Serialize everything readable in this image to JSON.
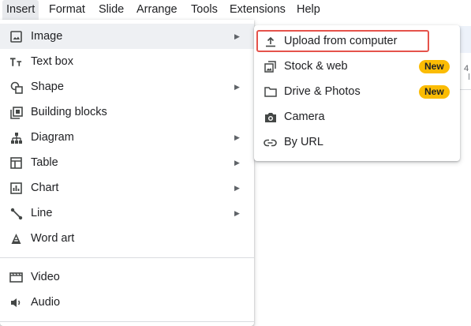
{
  "menubar": {
    "items": [
      "Insert",
      "Format",
      "Slide",
      "Arrange",
      "Tools",
      "Extensions",
      "Help"
    ]
  },
  "background": {
    "ruler_tick": "4"
  },
  "insert_menu": {
    "items": [
      {
        "label": "Image",
        "icon": "image-icon",
        "submenu": true
      },
      {
        "label": "Text box",
        "icon": "text-box-icon",
        "submenu": false
      },
      {
        "label": "Shape",
        "icon": "shape-icon",
        "submenu": true
      },
      {
        "label": "Building blocks",
        "icon": "building-blocks-icon",
        "submenu": false
      },
      {
        "label": "Diagram",
        "icon": "diagram-icon",
        "submenu": true
      },
      {
        "label": "Table",
        "icon": "table-icon",
        "submenu": true
      },
      {
        "label": "Chart",
        "icon": "chart-icon",
        "submenu": true
      },
      {
        "label": "Line",
        "icon": "line-icon",
        "submenu": true
      },
      {
        "label": "Word art",
        "icon": "word-art-icon",
        "submenu": false
      },
      {
        "label": "Video",
        "icon": "video-icon",
        "submenu": false
      },
      {
        "label": "Audio",
        "icon": "audio-icon",
        "submenu": false
      }
    ],
    "arrow": "▶"
  },
  "image_submenu": {
    "items": [
      {
        "label": "Upload from computer",
        "icon": "upload-icon"
      },
      {
        "label": "Stock & web",
        "icon": "stock-image-icon",
        "badge": "New"
      },
      {
        "label": "Drive & Photos",
        "icon": "folder-icon",
        "badge": "New"
      },
      {
        "label": "Camera",
        "icon": "camera-icon"
      },
      {
        "label": "By URL",
        "icon": "link-icon"
      }
    ]
  },
  "colors": {
    "accent_badge": "#fbbc04",
    "highlight_outline": "#e5534b",
    "hover": "#eef0f3"
  }
}
